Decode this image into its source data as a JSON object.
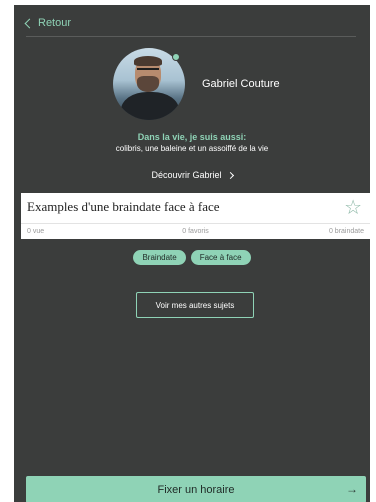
{
  "nav": {
    "back_label": "Retour"
  },
  "profile": {
    "name": "Gabriel Couture",
    "bio_title": "Dans la vie, je suis aussi:",
    "bio_text": "colibris, une baleine et un assoiffé de la vie",
    "discover_label": "Découvrir Gabriel"
  },
  "topic": {
    "title": "Examples d'une braindate face à face",
    "views": "0 vue",
    "favorites": "0 favoris",
    "braindates": "0 braindate",
    "tags": [
      "Braindate",
      "Face à face"
    ]
  },
  "actions": {
    "other_topics_label": "Voir mes autres sujets",
    "cta_label": "Fixer un horaire",
    "cta_arrow": "→"
  },
  "colors": {
    "background": "#3b3d3c",
    "accent": "#8fd3b6"
  },
  "icons": [
    "chevron-left-icon",
    "chevron-right-icon",
    "star-icon",
    "arrow-right-icon"
  ]
}
